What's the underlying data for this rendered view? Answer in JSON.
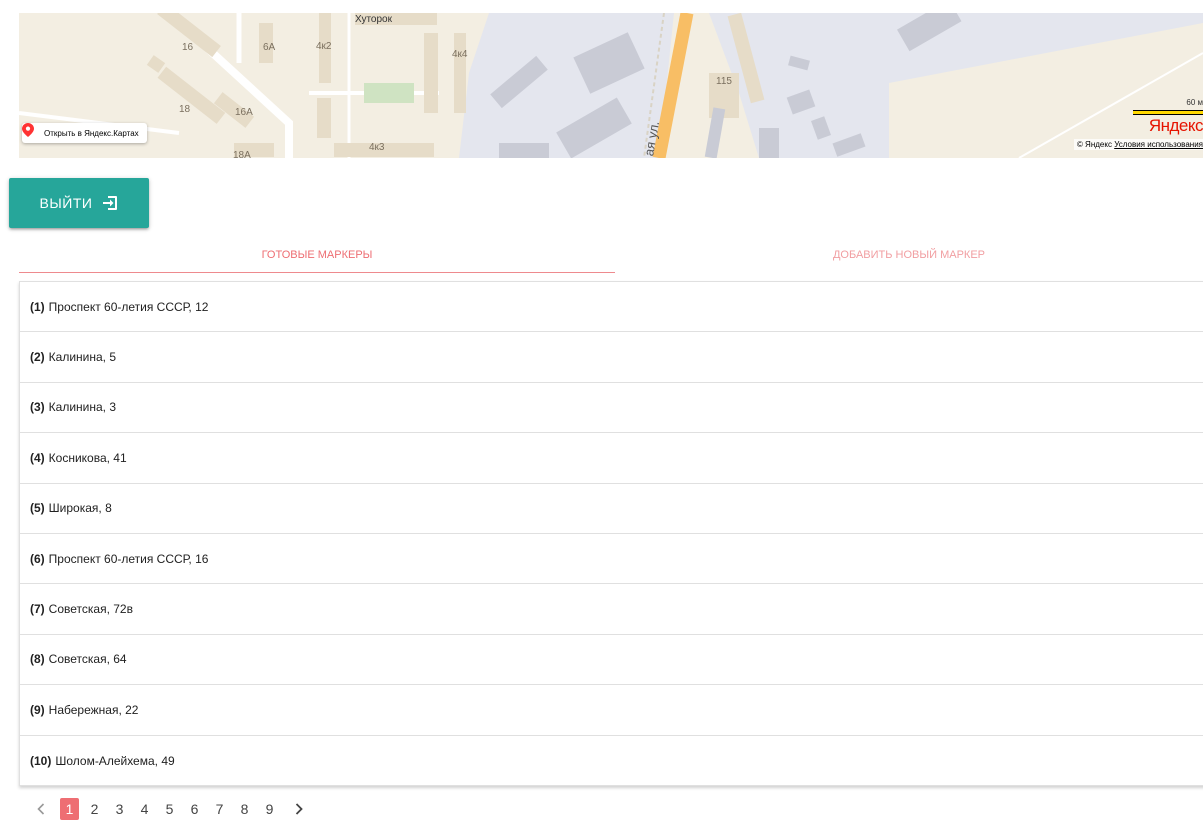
{
  "map": {
    "labels": {
      "khutorok": "Хуторок",
      "b16": "16",
      "b6a": "6А",
      "b4k2": "4к2",
      "b4k4": "4к4",
      "b18": "18",
      "b16a": "16А",
      "b18a": "18А",
      "b4k3": "4к3",
      "b115": "115",
      "street": "ая ул."
    },
    "open_link": "Открыть в Яндекс.Картах",
    "scale": "60 м",
    "logo": "Яндекс",
    "copyright": "© Яндекс",
    "terms": "Условия использования"
  },
  "logout": {
    "label": "ВЫЙТИ"
  },
  "tabs": [
    {
      "label": "ГОТОВЫЕ МАРКЕРЫ"
    },
    {
      "label": "ДОБАВИТЬ НОВЫЙ МАРКЕР"
    }
  ],
  "markers": [
    {
      "num": "(1)",
      "address": "Проспект 60-летия СССР, 12"
    },
    {
      "num": "(2)",
      "address": "Калинина, 5"
    },
    {
      "num": "(3)",
      "address": "Калинина, 3"
    },
    {
      "num": "(4)",
      "address": "Косникова, 41"
    },
    {
      "num": "(5)",
      "address": "Широкая, 8"
    },
    {
      "num": "(6)",
      "address": "Проспект 60-летия СССР, 16"
    },
    {
      "num": "(7)",
      "address": "Советская, 72в"
    },
    {
      "num": "(8)",
      "address": "Советская, 64"
    },
    {
      "num": "(9)",
      "address": "Набережная, 22"
    },
    {
      "num": "(10)",
      "address": "Шолом-Алейхема, 49"
    }
  ],
  "pagination": {
    "pages": [
      "1",
      "2",
      "3",
      "4",
      "5",
      "6",
      "7",
      "8",
      "9"
    ],
    "active": "1"
  },
  "colors": {
    "button": "#26a69a",
    "tab_text": "#ee6e73",
    "tab_indicator": "#ee8a8e",
    "active_page": "#ee6e73",
    "map_background": "#f3eee2",
    "map_industrial": "#e4e6ee",
    "map_road": "#f8be65"
  }
}
